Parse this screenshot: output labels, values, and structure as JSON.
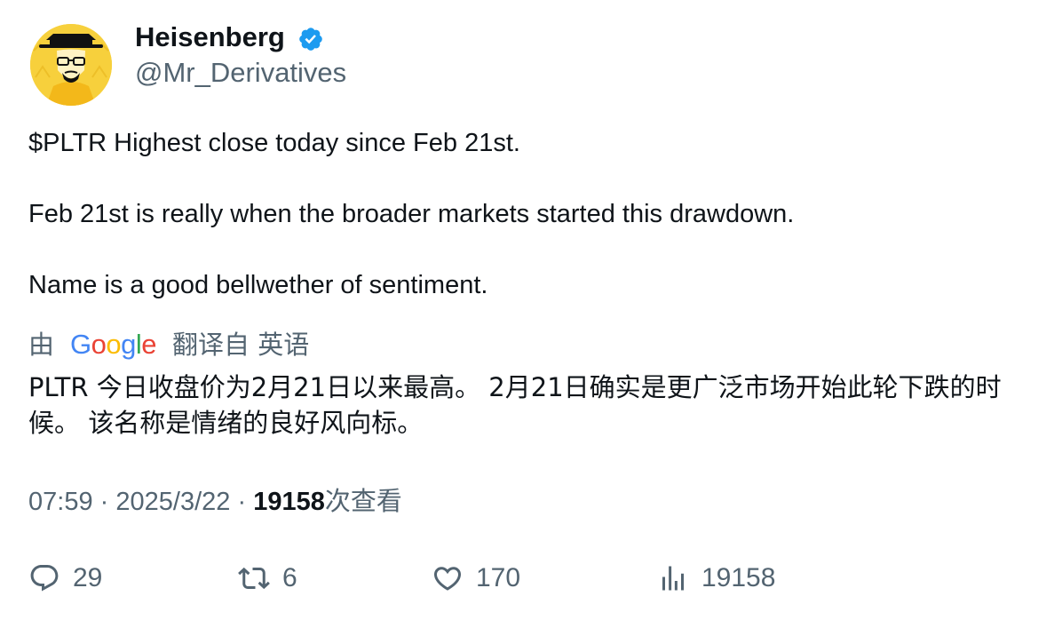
{
  "author": {
    "display_name": "Heisenberg",
    "handle": "@Mr_Derivatives",
    "verified_icon": "verified-badge-icon",
    "colors": {
      "verified": "#1d9bf0",
      "avatar_bg": "#f7d03c"
    }
  },
  "tweet": {
    "paragraphs": [
      "$PLTR Highest close today since Feb 21st.",
      "Feb 21st is really when the broader markets started this drawdown.",
      "Name is a good bellwether of sentiment."
    ]
  },
  "translation": {
    "prefix": "由",
    "provider_letters": [
      "G",
      "o",
      "o",
      "g",
      "l",
      "e"
    ],
    "provider_colors": [
      "#4285f4",
      "#ea4335",
      "#fbbc05",
      "#4285f4",
      "#34a853",
      "#ea4335"
    ],
    "suffix": "翻译自 英语",
    "text": "PLTR 今日收盘价为2月21日以来最高。 2月21日确实是更广泛市场开始此轮下跌的时候。 该名称是情绪的良好风向标。"
  },
  "meta": {
    "time": "07:59",
    "separator": "·",
    "date": "2025/3/22",
    "views_count": "19158",
    "views_label": "次查看"
  },
  "actions": {
    "reply": {
      "icon": "reply-icon",
      "count": "29"
    },
    "retweet": {
      "icon": "retweet-icon",
      "count": "6"
    },
    "like": {
      "icon": "heart-icon",
      "count": "170"
    },
    "views": {
      "icon": "views-chart-icon",
      "count": "19158"
    }
  }
}
